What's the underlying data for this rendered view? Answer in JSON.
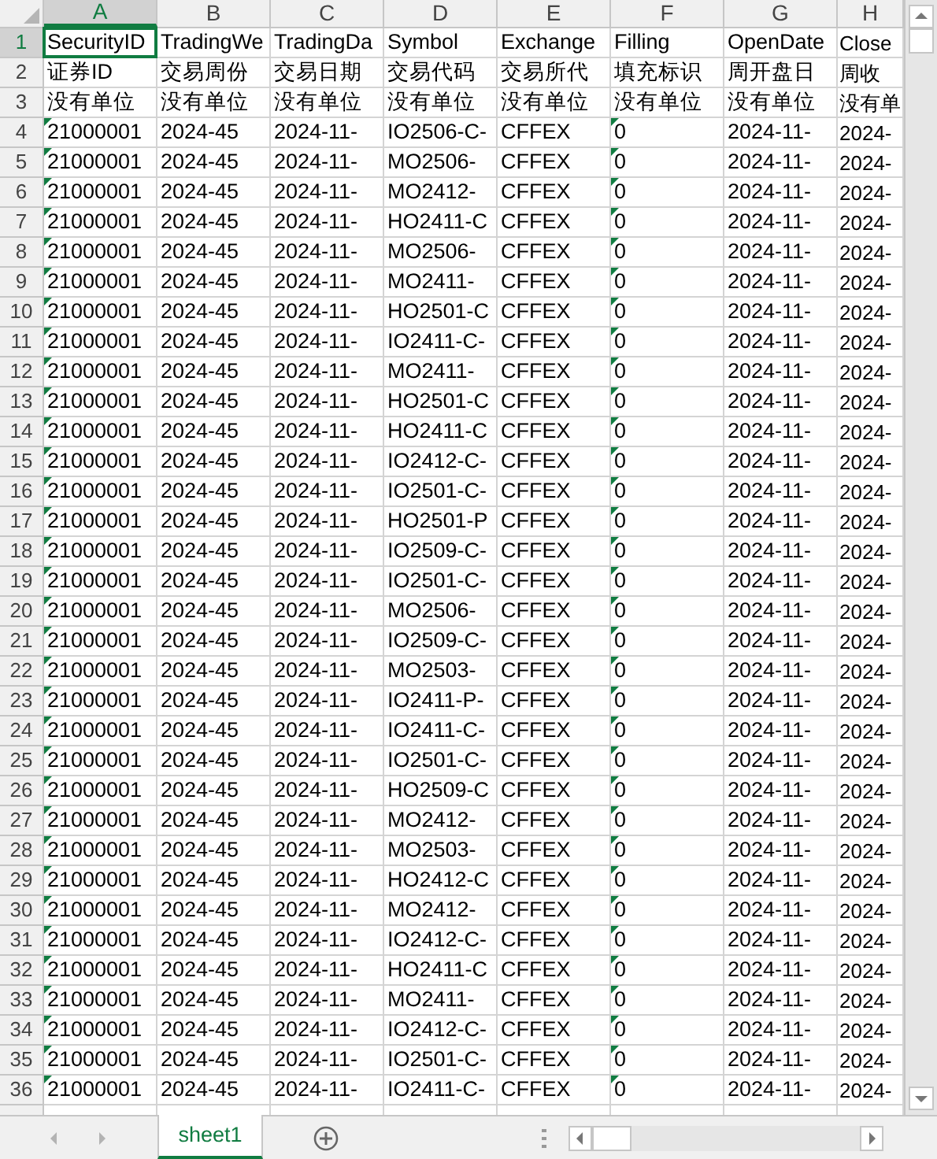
{
  "columns": [
    {
      "letter": "A",
      "selected": true,
      "flagged": true
    },
    {
      "letter": "B",
      "selected": false,
      "flagged": false
    },
    {
      "letter": "C",
      "selected": false,
      "flagged": false
    },
    {
      "letter": "D",
      "selected": false,
      "flagged": false
    },
    {
      "letter": "E",
      "selected": false,
      "flagged": false
    },
    {
      "letter": "F",
      "selected": false,
      "flagged": true
    },
    {
      "letter": "G",
      "selected": false,
      "flagged": false
    },
    {
      "letter": "H",
      "selected": false,
      "flagged": false
    }
  ],
  "rows": [
    {
      "number": "1",
      "selected": true,
      "kind": "header",
      "cells": [
        "SecurityID",
        "TradingWe",
        "TradingDa",
        "Symbol",
        "Exchange",
        "Filling",
        "OpenDate",
        "Close"
      ]
    },
    {
      "number": "2",
      "selected": false,
      "kind": "header",
      "cells": [
        "证券ID",
        "交易周份",
        "交易日期",
        "交易代码",
        "交易所代",
        "填充标识",
        "周开盘日",
        "周收"
      ]
    },
    {
      "number": "3",
      "selected": false,
      "kind": "header",
      "cells": [
        "没有单位",
        "没有单位",
        "没有单位",
        "没有单位",
        "没有单位",
        "没有单位",
        "没有单位",
        "没有单"
      ]
    },
    {
      "number": "4",
      "selected": false,
      "kind": "data",
      "cells": [
        "21000001",
        "2024-45",
        "2024-11-",
        "IO2506-C-",
        "CFFEX",
        "0",
        "2024-11-",
        "2024-"
      ]
    },
    {
      "number": "5",
      "selected": false,
      "kind": "data",
      "cells": [
        "21000001",
        "2024-45",
        "2024-11-",
        "MO2506-",
        "CFFEX",
        "0",
        "2024-11-",
        "2024-"
      ]
    },
    {
      "number": "6",
      "selected": false,
      "kind": "data",
      "cells": [
        "21000001",
        "2024-45",
        "2024-11-",
        "MO2412-",
        "CFFEX",
        "0",
        "2024-11-",
        "2024-"
      ]
    },
    {
      "number": "7",
      "selected": false,
      "kind": "data",
      "cells": [
        "21000001",
        "2024-45",
        "2024-11-",
        "HO2411-C",
        "CFFEX",
        "0",
        "2024-11-",
        "2024-"
      ]
    },
    {
      "number": "8",
      "selected": false,
      "kind": "data",
      "cells": [
        "21000001",
        "2024-45",
        "2024-11-",
        "MO2506-",
        "CFFEX",
        "0",
        "2024-11-",
        "2024-"
      ]
    },
    {
      "number": "9",
      "selected": false,
      "kind": "data",
      "cells": [
        "21000001",
        "2024-45",
        "2024-11-",
        "MO2411-",
        "CFFEX",
        "0",
        "2024-11-",
        "2024-"
      ]
    },
    {
      "number": "10",
      "selected": false,
      "kind": "data",
      "cells": [
        "21000001",
        "2024-45",
        "2024-11-",
        "HO2501-C",
        "CFFEX",
        "0",
        "2024-11-",
        "2024-"
      ]
    },
    {
      "number": "11",
      "selected": false,
      "kind": "data",
      "cells": [
        "21000001",
        "2024-45",
        "2024-11-",
        "IO2411-C-",
        "CFFEX",
        "0",
        "2024-11-",
        "2024-"
      ]
    },
    {
      "number": "12",
      "selected": false,
      "kind": "data",
      "cells": [
        "21000001",
        "2024-45",
        "2024-11-",
        "MO2411-",
        "CFFEX",
        "0",
        "2024-11-",
        "2024-"
      ]
    },
    {
      "number": "13",
      "selected": false,
      "kind": "data",
      "cells": [
        "21000001",
        "2024-45",
        "2024-11-",
        "HO2501-C",
        "CFFEX",
        "0",
        "2024-11-",
        "2024-"
      ]
    },
    {
      "number": "14",
      "selected": false,
      "kind": "data",
      "cells": [
        "21000001",
        "2024-45",
        "2024-11-",
        "HO2411-C",
        "CFFEX",
        "0",
        "2024-11-",
        "2024-"
      ]
    },
    {
      "number": "15",
      "selected": false,
      "kind": "data",
      "cells": [
        "21000001",
        "2024-45",
        "2024-11-",
        "IO2412-C-",
        "CFFEX",
        "0",
        "2024-11-",
        "2024-"
      ]
    },
    {
      "number": "16",
      "selected": false,
      "kind": "data",
      "cells": [
        "21000001",
        "2024-45",
        "2024-11-",
        "IO2501-C-",
        "CFFEX",
        "0",
        "2024-11-",
        "2024-"
      ]
    },
    {
      "number": "17",
      "selected": false,
      "kind": "data",
      "cells": [
        "21000001",
        "2024-45",
        "2024-11-",
        "HO2501-P",
        "CFFEX",
        "0",
        "2024-11-",
        "2024-"
      ]
    },
    {
      "number": "18",
      "selected": false,
      "kind": "data",
      "cells": [
        "21000001",
        "2024-45",
        "2024-11-",
        "IO2509-C-",
        "CFFEX",
        "0",
        "2024-11-",
        "2024-"
      ]
    },
    {
      "number": "19",
      "selected": false,
      "kind": "data",
      "cells": [
        "21000001",
        "2024-45",
        "2024-11-",
        "IO2501-C-",
        "CFFEX",
        "0",
        "2024-11-",
        "2024-"
      ]
    },
    {
      "number": "20",
      "selected": false,
      "kind": "data",
      "cells": [
        "21000001",
        "2024-45",
        "2024-11-",
        "MO2506-",
        "CFFEX",
        "0",
        "2024-11-",
        "2024-"
      ]
    },
    {
      "number": "21",
      "selected": false,
      "kind": "data",
      "cells": [
        "21000001",
        "2024-45",
        "2024-11-",
        "IO2509-C-",
        "CFFEX",
        "0",
        "2024-11-",
        "2024-"
      ]
    },
    {
      "number": "22",
      "selected": false,
      "kind": "data",
      "cells": [
        "21000001",
        "2024-45",
        "2024-11-",
        "MO2503-",
        "CFFEX",
        "0",
        "2024-11-",
        "2024-"
      ]
    },
    {
      "number": "23",
      "selected": false,
      "kind": "data",
      "cells": [
        "21000001",
        "2024-45",
        "2024-11-",
        "IO2411-P-",
        "CFFEX",
        "0",
        "2024-11-",
        "2024-"
      ]
    },
    {
      "number": "24",
      "selected": false,
      "kind": "data",
      "cells": [
        "21000001",
        "2024-45",
        "2024-11-",
        "IO2411-C-",
        "CFFEX",
        "0",
        "2024-11-",
        "2024-"
      ]
    },
    {
      "number": "25",
      "selected": false,
      "kind": "data",
      "cells": [
        "21000001",
        "2024-45",
        "2024-11-",
        "IO2501-C-",
        "CFFEX",
        "0",
        "2024-11-",
        "2024-"
      ]
    },
    {
      "number": "26",
      "selected": false,
      "kind": "data",
      "cells": [
        "21000001",
        "2024-45",
        "2024-11-",
        "HO2509-C",
        "CFFEX",
        "0",
        "2024-11-",
        "2024-"
      ]
    },
    {
      "number": "27",
      "selected": false,
      "kind": "data",
      "cells": [
        "21000001",
        "2024-45",
        "2024-11-",
        "MO2412-",
        "CFFEX",
        "0",
        "2024-11-",
        "2024-"
      ]
    },
    {
      "number": "28",
      "selected": false,
      "kind": "data",
      "cells": [
        "21000001",
        "2024-45",
        "2024-11-",
        "MO2503-",
        "CFFEX",
        "0",
        "2024-11-",
        "2024-"
      ]
    },
    {
      "number": "29",
      "selected": false,
      "kind": "data",
      "cells": [
        "21000001",
        "2024-45",
        "2024-11-",
        "HO2412-C",
        "CFFEX",
        "0",
        "2024-11-",
        "2024-"
      ]
    },
    {
      "number": "30",
      "selected": false,
      "kind": "data",
      "cells": [
        "21000001",
        "2024-45",
        "2024-11-",
        "MO2412-",
        "CFFEX",
        "0",
        "2024-11-",
        "2024-"
      ]
    },
    {
      "number": "31",
      "selected": false,
      "kind": "data",
      "cells": [
        "21000001",
        "2024-45",
        "2024-11-",
        "IO2412-C-",
        "CFFEX",
        "0",
        "2024-11-",
        "2024-"
      ]
    },
    {
      "number": "32",
      "selected": false,
      "kind": "data",
      "cells": [
        "21000001",
        "2024-45",
        "2024-11-",
        "HO2411-C",
        "CFFEX",
        "0",
        "2024-11-",
        "2024-"
      ]
    },
    {
      "number": "33",
      "selected": false,
      "kind": "data",
      "cells": [
        "21000001",
        "2024-45",
        "2024-11-",
        "MO2411-",
        "CFFEX",
        "0",
        "2024-11-",
        "2024-"
      ]
    },
    {
      "number": "34",
      "selected": false,
      "kind": "data",
      "cells": [
        "21000001",
        "2024-45",
        "2024-11-",
        "IO2412-C-",
        "CFFEX",
        "0",
        "2024-11-",
        "2024-"
      ]
    },
    {
      "number": "35",
      "selected": false,
      "kind": "data",
      "cells": [
        "21000001",
        "2024-45",
        "2024-11-",
        "IO2501-C-",
        "CFFEX",
        "0",
        "2024-11-",
        "2024-"
      ]
    },
    {
      "number": "36",
      "selected": false,
      "kind": "data",
      "cells": [
        "21000001",
        "2024-45",
        "2024-11-",
        "IO2411-C-",
        "CFFEX",
        "0",
        "2024-11-",
        "2024-"
      ]
    }
  ],
  "sheet_tabs": [
    {
      "label": "sheet1",
      "selected": true
    }
  ]
}
